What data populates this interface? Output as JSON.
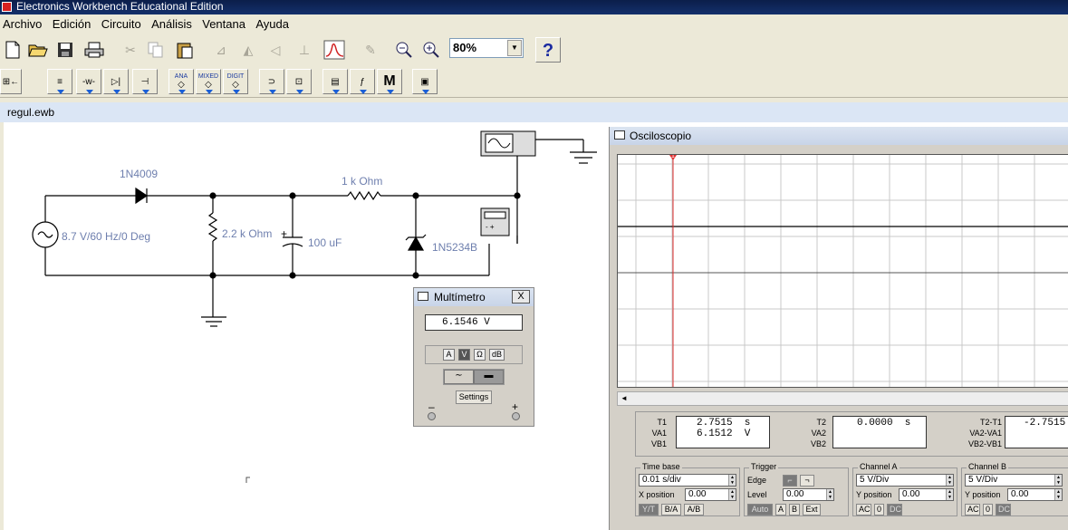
{
  "app": {
    "title": "Electronics Workbench Educational Edition"
  },
  "menu": [
    "Archivo",
    "Edición",
    "Circuito",
    "Análisis",
    "Ventana",
    "Ayuda"
  ],
  "toolbar": {
    "zoom_value": "80%",
    "help_label": "?"
  },
  "toolbar2": {
    "ana_label": "ANA",
    "mixed_label": "MIXED",
    "digit_label": "DIGIT",
    "m_label": "M"
  },
  "document": {
    "filename": "regul.ewb"
  },
  "circuit": {
    "source_label": "8.7 V/60 Hz/0 Deg",
    "diode_label": "1N4009",
    "resistor1_label": "2.2 k Ohm",
    "capacitor_label": "100 uF",
    "resistor2_label": "1 k Ohm",
    "zener_label": "1N5234B",
    "cap_plus": "+"
  },
  "multimeter": {
    "title": "Multímetro",
    "close_label": "X",
    "reading": "6.1546  V",
    "modes": [
      "A",
      "V",
      "Ω",
      "dB"
    ],
    "active_mode": "V",
    "settings_label": "Settings",
    "minus_label": "–",
    "plus_label": "+"
  },
  "oscilloscope": {
    "title": "Osciloscopio",
    "cursor_label": "1",
    "scroll_left": "◄",
    "readout": {
      "t1_labels": [
        "T1",
        "VA1",
        "VB1"
      ],
      "t1_lines": [
        "2.7515  s",
        "6.1512  V",
        ""
      ],
      "t2_labels": [
        "T2",
        "VA2",
        "VB2"
      ],
      "t2_lines": [
        "0.0000  s",
        "",
        ""
      ],
      "diff_labels": [
        "T2-T1",
        "VA2-VA1",
        "VB2-VB1"
      ],
      "diff_lines": [
        "-2.7515",
        "",
        ""
      ]
    },
    "timebase": {
      "title": "Time base",
      "value": "0.01 s/div",
      "xpos_label": "X position",
      "xpos_value": "0.00",
      "buttons": [
        "Y/T",
        "B/A",
        "A/B"
      ]
    },
    "trigger": {
      "title": "Trigger",
      "edge_label": "Edge",
      "level_label": "Level",
      "level_value": "0.00",
      "buttons": [
        "Auto",
        "A",
        "B",
        "Ext"
      ]
    },
    "channel_a": {
      "title": "Channel A",
      "value": "5  V/Div",
      "ypos_label": "Y position",
      "ypos_value": "0.00",
      "buttons": [
        "AC",
        "0",
        "DC"
      ]
    },
    "channel_b": {
      "title": "Channel B",
      "value": "5  V/Div",
      "ypos_label": "Y position",
      "ypos_value": "0.00",
      "buttons": [
        "AC",
        "0",
        "DC"
      ]
    }
  }
}
